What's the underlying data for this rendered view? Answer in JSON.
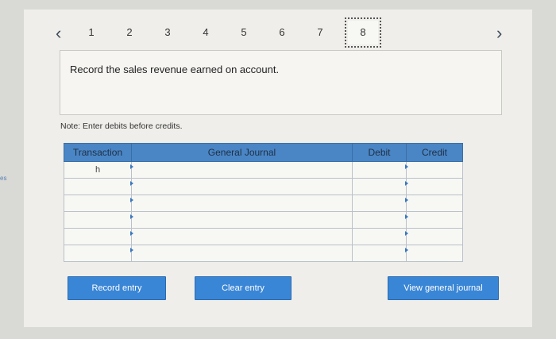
{
  "side_label": "es",
  "nav": {
    "prev_icon": "chevron-left-icon",
    "next_icon": "chevron-right-icon",
    "steps": [
      "1",
      "2",
      "3",
      "4",
      "5",
      "6",
      "7",
      "8"
    ],
    "active_step": "8"
  },
  "prompt": "Record the sales revenue earned on account.",
  "note": "Note: Enter debits before credits.",
  "table": {
    "headers": [
      "Transaction",
      "General Journal",
      "Debit",
      "Credit"
    ],
    "rows": [
      {
        "transaction": "h",
        "account": "",
        "debit": "",
        "credit": ""
      },
      {
        "transaction": "",
        "account": "",
        "debit": "",
        "credit": ""
      },
      {
        "transaction": "",
        "account": "",
        "debit": "",
        "credit": ""
      },
      {
        "transaction": "",
        "account": "",
        "debit": "",
        "credit": ""
      },
      {
        "transaction": "",
        "account": "",
        "debit": "",
        "credit": ""
      },
      {
        "transaction": "",
        "account": "",
        "debit": "",
        "credit": ""
      }
    ]
  },
  "buttons": {
    "record": "Record entry",
    "clear": "Clear entry",
    "view": "View general journal"
  },
  "colors": {
    "header_blue": "#4a86c5",
    "button_blue": "#3a86d6"
  }
}
